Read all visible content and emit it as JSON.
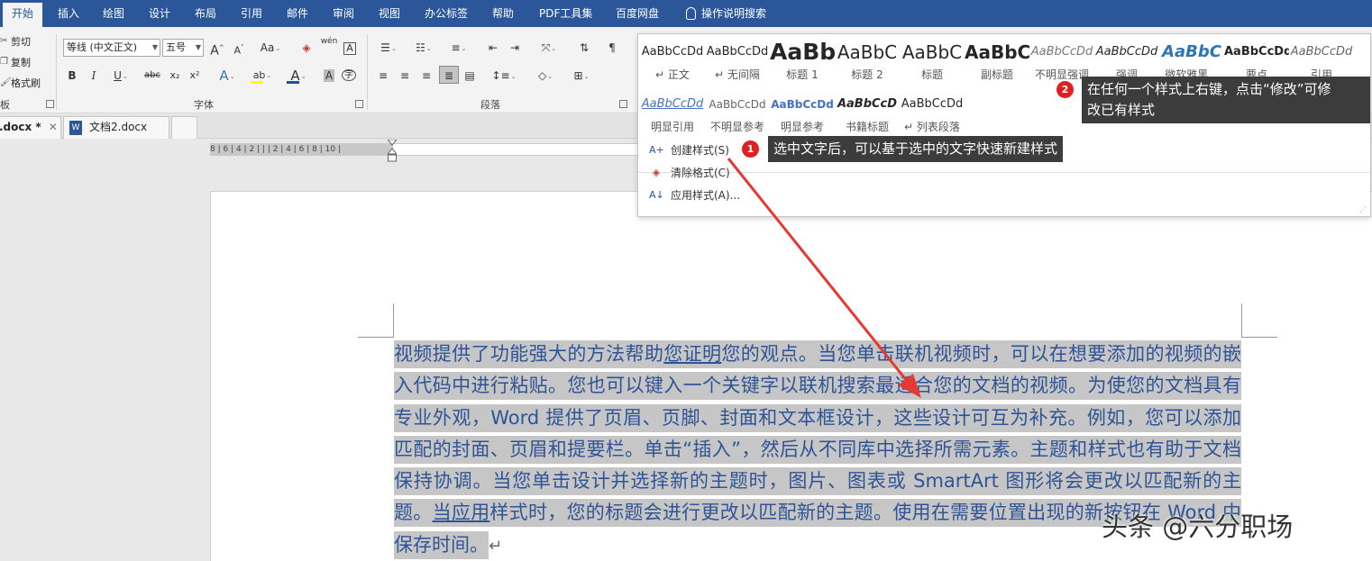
{
  "tabs": [
    "开始",
    "插入",
    "绘图",
    "设计",
    "布局",
    "引用",
    "邮件",
    "审阅",
    "视图",
    "办公标签",
    "帮助",
    "PDF工具集",
    "百度网盘"
  ],
  "search_tab": "操作说明搜索",
  "clipboard": {
    "cut": "剪切",
    "copy": "复制",
    "format_painter": "格式刷",
    "group": "板"
  },
  "font": {
    "font_name": "等线 (中文正文)",
    "font_size": "五号",
    "grow": "A",
    "shrink": "A",
    "change_case": "Aa",
    "bold": "B",
    "italic": "I",
    "underline": "U",
    "strike": "abc",
    "subscript": "x₂",
    "superscript": "x²",
    "text_effects": "A",
    "highlight": "ab",
    "font_color": "A",
    "char_shading": "A",
    "enclose": "字",
    "phonetic": "wén",
    "group": "字体"
  },
  "paragraph": {
    "group": "段落"
  },
  "doc_tabs": [
    {
      "name": ".docx *",
      "close": "✕"
    },
    {
      "name": "文档2.docx"
    }
  ],
  "ruler_text": "8 | 6 | 4 | 2 |   |   | 2 | 4 | 6 | 8 | 10 |",
  "styles_gallery": {
    "row1": [
      {
        "preview": "AaBbCcDd",
        "name": "正文"
      },
      {
        "preview": "AaBbCcDd",
        "name": "无间隔"
      },
      {
        "preview": "AaBb",
        "name": "标题 1"
      },
      {
        "preview": "AaBbC",
        "name": "标题 2"
      },
      {
        "preview": "AaBbC",
        "name": "标题"
      },
      {
        "preview": "AaBbC",
        "name": "副标题"
      },
      {
        "preview": "AaBbCcDd",
        "name": "不明显强调"
      },
      {
        "preview": "AaBbCcDd",
        "name": "强调"
      },
      {
        "preview": "AaBbC",
        "name": "微软雅黑..."
      },
      {
        "preview": "AaBbCcDd",
        "name": "要点"
      },
      {
        "preview": "AaBbCcDd",
        "name": "引用"
      }
    ],
    "row2": [
      {
        "preview": "AaBbCcDd",
        "name": "明显引用"
      },
      {
        "preview": "AaBbCcDd",
        "name": "不明显参考"
      },
      {
        "preview": "AaBbCcDd",
        "name": "明显参考"
      },
      {
        "preview": "AaBbCcD",
        "name": "书籍标题"
      },
      {
        "preview": "AaBbCcDd",
        "name": "列表段落"
      }
    ],
    "menu": [
      "创建样式(S)",
      "清除格式(C)",
      "应用样式(A)..."
    ]
  },
  "callouts": [
    {
      "num": "1",
      "text": "选中文字后，可以基于选中的文字快速新建样式"
    },
    {
      "num": "2",
      "text_line1": "在任何一个样式上右键，点击“修改”可修",
      "text_line2": "改已有样式"
    }
  ],
  "document": {
    "s1": "视频提供了功能强大的方法帮助",
    "s2": "您证明",
    "s3": "您的观点。当您单击联机视频时，可以在想要添加的视频的嵌入代码中进行粘贴。您也可以键入一个关键字以联机搜索最适合您的文档的视频。为使您的文档具有专业外观，Word 提供了页眉、页脚、封面和文本框设计，这些设计可互为补充。例如，您可以添加匹配的封面、页眉和提要栏。单击“插入”，然后从不同库中选择所需元素。主题和样式也有助于文档保持协调。当您单击设计并选择新的主题时，图片、图表或 SmartArt 图形将会更改以匹配新的主题。",
    "s4": "当应用",
    "s5": "样式时，您的标题会进行更改以匹配新的主题。使用在需要位置出现的新按钮在 Word 中保存时间。",
    "ret": "↵"
  },
  "watermark": "头条 @六分职场"
}
